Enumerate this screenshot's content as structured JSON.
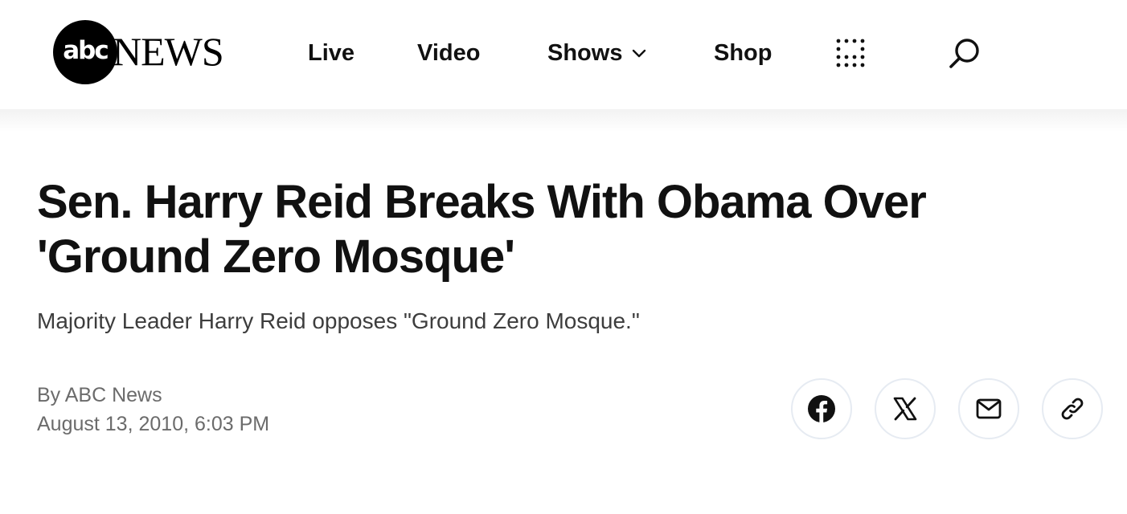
{
  "header": {
    "logo": {
      "mark_text": "abc",
      "word_text": "NEWS"
    },
    "nav": [
      {
        "label": "Live"
      },
      {
        "label": "Video"
      },
      {
        "label": "Shows",
        "icon": "chevron-down-icon"
      },
      {
        "label": "Shop"
      }
    ],
    "apps_icon": "grid-dots-icon",
    "search_icon": "search-icon"
  },
  "article": {
    "headline": "Sen. Harry Reid Breaks With Obama Over 'Ground Zero Mosque'",
    "subheadline": "Majority Leader Harry Reid opposes \"Ground Zero Mosque.\"",
    "byline": "By ABC News",
    "timestamp": "August 13, 2010, 6:03 PM"
  },
  "share": [
    {
      "icon": "facebook-icon"
    },
    {
      "icon": "x-icon"
    },
    {
      "icon": "email-icon"
    },
    {
      "icon": "link-icon"
    }
  ],
  "colors": {
    "text": "#111111",
    "muted": "#6b6b6b",
    "share_border": "#e6ebf2"
  }
}
